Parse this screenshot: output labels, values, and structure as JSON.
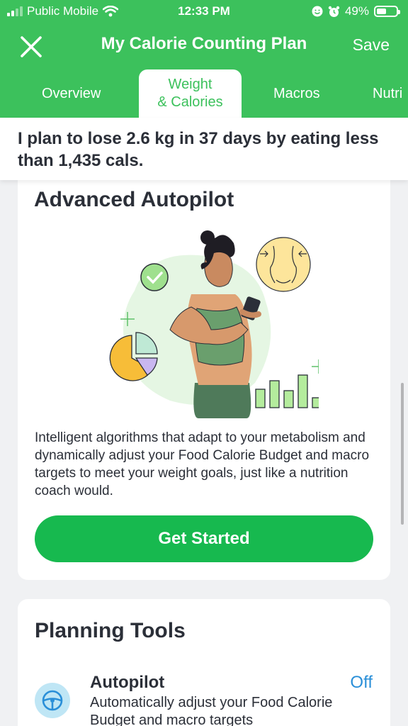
{
  "status_bar": {
    "carrier": "Public Mobile",
    "time": "12:33 PM",
    "battery": "49%",
    "battery_level": 0.49,
    "icons": [
      "signal-icon",
      "wifi-icon",
      "smiley-icon",
      "alarm-icon",
      "battery-icon"
    ]
  },
  "nav": {
    "title": "My Calorie Counting Plan",
    "save_label": "Save",
    "close_icon": "close-icon"
  },
  "tabs": [
    {
      "label": "Overview"
    },
    {
      "label_line1": "Weight",
      "label_line2": "& Calories",
      "selected": true
    },
    {
      "label": "Macros"
    },
    {
      "label": "Nutri"
    }
  ],
  "summary": {
    "text": "I plan to lose 2.6 kg in 37 days by eating less than 1,435 cals."
  },
  "autopilot_card": {
    "title": "Advanced Autopilot",
    "description": "Intelligent algorithms that adapt to your metabolism and dynamically adjust your Food Calorie Budget and macro targets to meet your weight goals, just like a nutrition coach would.",
    "cta_label": "Get Started"
  },
  "planning_card": {
    "title": "Planning Tools",
    "tools": [
      {
        "name": "Autopilot",
        "description": "Automatically adjust your Food Calorie Budget and macro targets",
        "toggle": "Off",
        "icon": "steering-wheel-icon"
      }
    ]
  },
  "colors": {
    "brand_green": "#3cc15c",
    "button_green": "#17b94f",
    "link_blue": "#2a8fd8",
    "text_dark": "#2b2f38"
  }
}
